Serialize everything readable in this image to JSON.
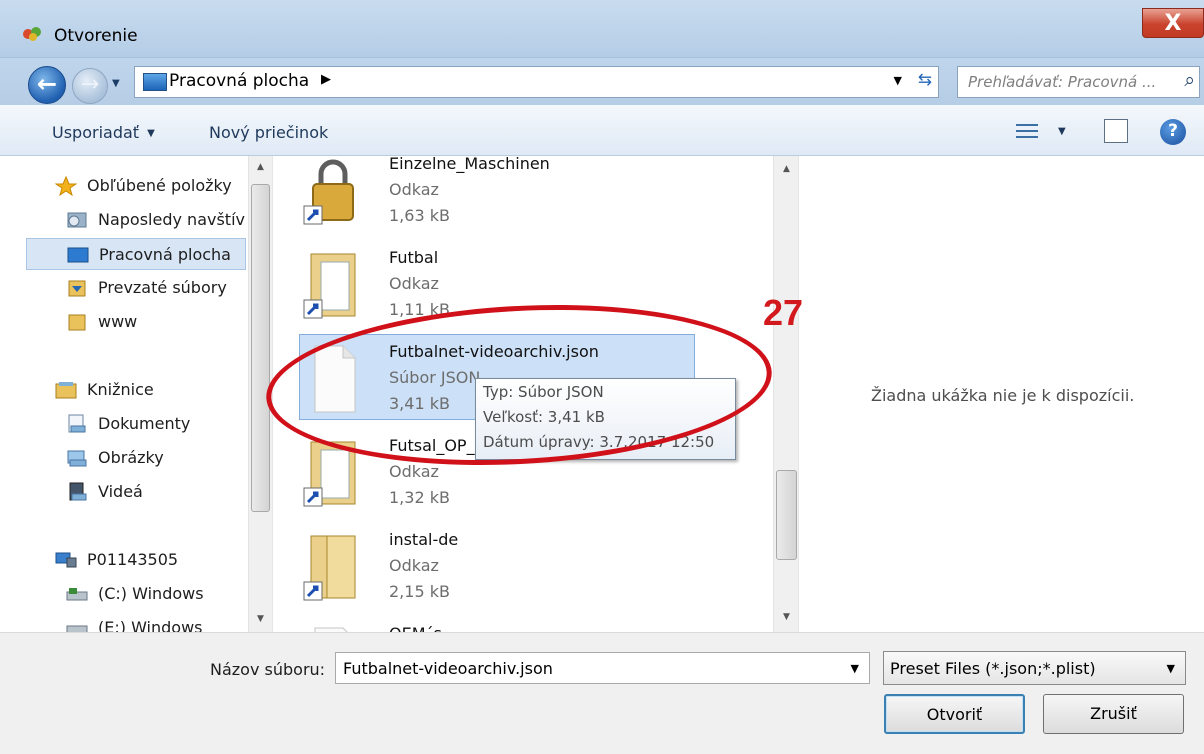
{
  "window": {
    "title": "Otvorenie",
    "close_label": "X"
  },
  "address": {
    "breadcrumb": "Pracovná plocha",
    "search_placeholder": "Prehľadávať: Pracovná ..."
  },
  "toolbar": {
    "organize": "Usporiadať",
    "new_folder": "Nový priečinok"
  },
  "nav": {
    "favorites": "Obľúbené položky",
    "recent": "Naposledy navštív",
    "desktop": "Pracovná plocha",
    "downloads": "Prevzaté súbory",
    "www": "www",
    "libraries": "Knižnice",
    "documents": "Dokumenty",
    "pictures": "Obrázky",
    "videos": "Videá",
    "computer": "P01143505",
    "drive_c": "(C:) Windows",
    "drive_e": "(E:) Windows"
  },
  "files": [
    {
      "name": "Einzelne_Maschinen",
      "type": "Odkaz",
      "size": "1,63 kB"
    },
    {
      "name": "Futbal",
      "type": "Odkaz",
      "size": "1,11 kB"
    },
    {
      "name": "Futbalnet-videoarchiv.json",
      "type": "Súbor JSON",
      "size": "3,41 kB"
    },
    {
      "name": "Futsal_OP_",
      "type": "Odkaz",
      "size": "1,32 kB"
    },
    {
      "name": "instal-de",
      "type": "Odkaz",
      "size": "2,15 kB"
    },
    {
      "name": "OEM´s",
      "type": "",
      "size": ""
    }
  ],
  "tooltip": {
    "type": "Typ: Súbor JSON",
    "size": "Veľkosť: 3,41 kB",
    "modified": "Dátum úpravy: 3.7.2017 12:50"
  },
  "preview": {
    "message": "Žiadna ukážka nie je k dispozícii."
  },
  "annotation": {
    "number": "27"
  },
  "footer": {
    "filename_label": "Názov súboru:",
    "filename_value": "Futbalnet-videoarchiv.json",
    "filter": "Preset Files (*.json;*.plist)",
    "open": "Otvoriť",
    "cancel": "Zrušiť"
  }
}
